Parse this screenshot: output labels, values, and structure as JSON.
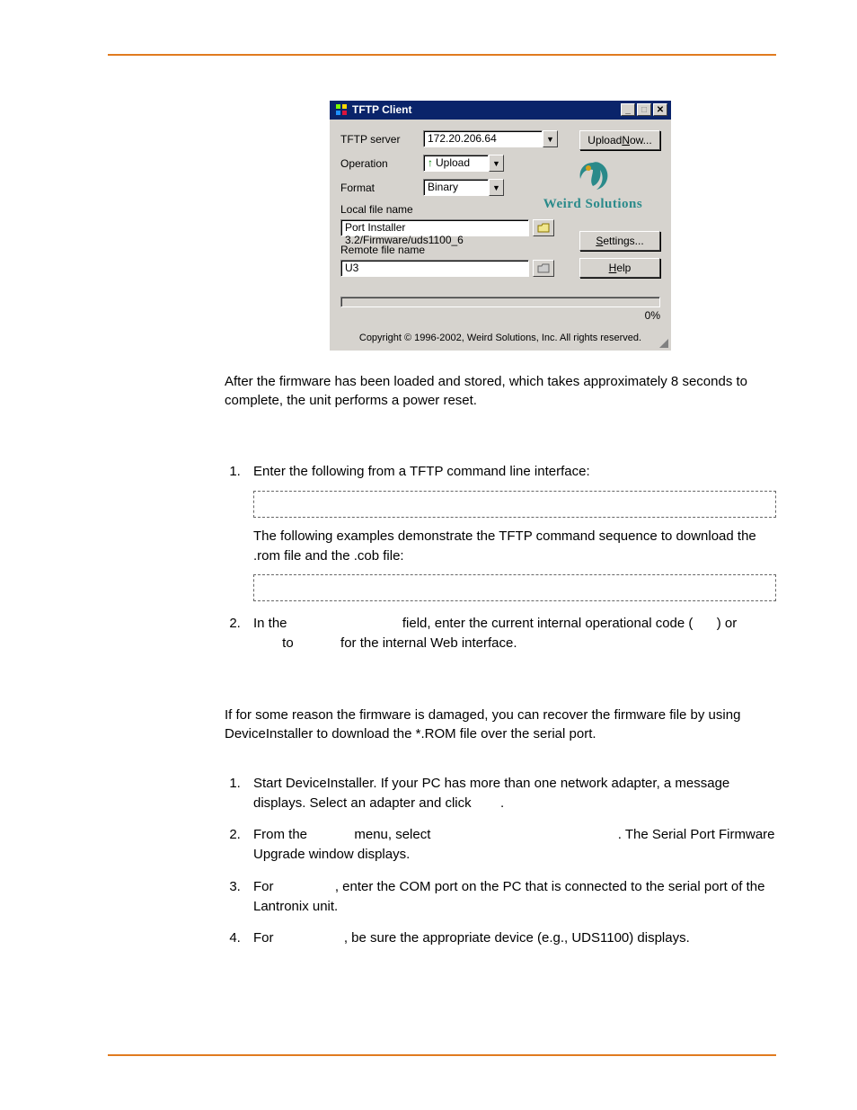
{
  "tftp": {
    "title": "TFTP Client",
    "labels": {
      "server": "TFTP server",
      "operation": "Operation",
      "format": "Format",
      "localfile": "Local file name",
      "remotefile": "Remote file name"
    },
    "values": {
      "server": "172.20.206.64",
      "operation": "Upload",
      "format": "Binary",
      "localfile": "Port Installer 3.2/Firmware/uds1100_6",
      "remotefile": "U3"
    },
    "buttons": {
      "upload": "Upload Now...",
      "settings": "Settings...",
      "help": "Help"
    },
    "logo": "Weird Solutions",
    "progress_pct": "0%",
    "copyright": "Copyright © 1996-2002, Weird Solutions, Inc. All rights reserved."
  },
  "para_after_window": "After the firmware has been loaded and stored, which takes approximately 8 seconds to complete, the unit performs a power reset.",
  "steps1": {
    "item1": "Enter the following from a TFTP command line interface:",
    "item1_note": "The following examples demonstrate the TFTP command sequence to download the .rom file and the .cob file:",
    "item2_a": "In the ",
    "item2_b": " field, enter the current internal operational code (",
    "item2_c": ") or ",
    "item2_d": " to ",
    "item2_e": " for the internal Web interface."
  },
  "recover_intro": "If for some reason the firmware is damaged, you can recover the firmware file by using DeviceInstaller to download the *.ROM file over the serial port.",
  "steps2": {
    "s1": "Start DeviceInstaller. If your PC has more than one network adapter, a message displays. Select an adapter and click ",
    "s1_end": ".",
    "s2_a": "From the ",
    "s2_b": " menu, select ",
    "s2_c": ". The Serial Port Firmware Upgrade window displays.",
    "s3_a": "For ",
    "s3_b": ", enter the COM port on the PC that is connected to the serial port of the Lantronix unit.",
    "s4_a": "For ",
    "s4_b": ", be sure the appropriate device (e.g., UDS1100) displays."
  }
}
